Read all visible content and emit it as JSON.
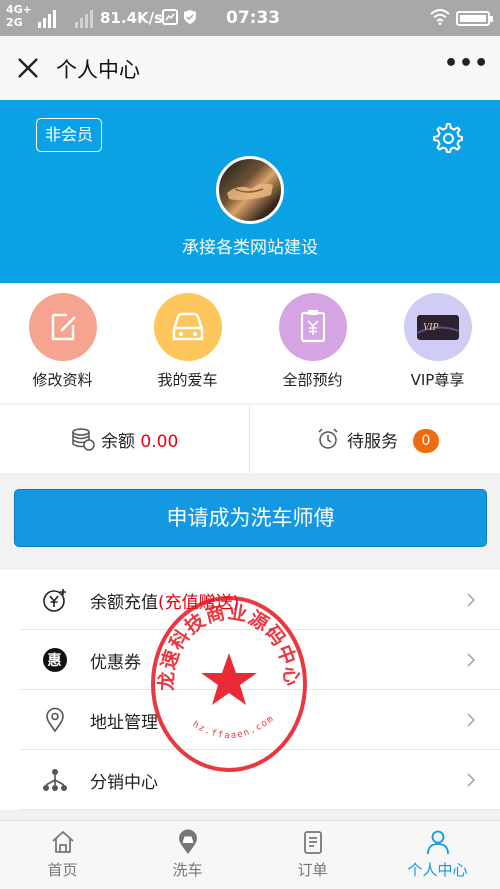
{
  "status_bar": {
    "network_top": "4G+",
    "network_bottom": "2G",
    "speed": "81.4K/s",
    "time": "07:33",
    "battery_level": 1.0,
    "icons": [
      "signal-icon",
      "image-notification-icon",
      "shield-icon",
      "wifi-icon",
      "battery-icon"
    ]
  },
  "title_bar": {
    "title": "个人中心",
    "close_icon": "close-icon",
    "more_icon": "more-icon",
    "more_text": "•••"
  },
  "profile": {
    "member_badge": "非会员",
    "username": "承接各类网站建设",
    "settings_icon": "gear-icon",
    "header_color": "#0aa2e5"
  },
  "quick_actions": [
    {
      "label": "修改资料",
      "icon": "edit-icon",
      "color": "#f6a38f"
    },
    {
      "label": "我的爱车",
      "icon": "car-icon",
      "color": "#fcc65c"
    },
    {
      "label": "全部预约",
      "icon": "appointment-icon",
      "color": "#d5a4e3"
    },
    {
      "label": "VIP尊享",
      "icon": "vip-card-icon",
      "color": "#cfcdf4"
    }
  ],
  "stats": {
    "balance_label": "余额",
    "balance_value": "0.00",
    "pending_label": "待服务",
    "pending_count": "0"
  },
  "apply_button": "申请成为洗车师傅",
  "menu": [
    {
      "label": "余额充值",
      "extra": "(充值赠送)",
      "icon": "recharge-icon"
    },
    {
      "label": "优惠券",
      "extra": "",
      "icon": "coupon-icon"
    },
    {
      "label": "地址管理",
      "extra": "",
      "icon": "location-icon"
    },
    {
      "label": "分销中心",
      "extra": "",
      "icon": "distribution-icon"
    }
  ],
  "watermark": {
    "text": "龙速科技商业源码中心",
    "url": "hz.ffaaen.com",
    "color": "#e8141f"
  },
  "tabs": [
    {
      "label": "首页",
      "icon": "home-icon",
      "active": false
    },
    {
      "label": "洗车",
      "icon": "wash-car-icon",
      "active": false
    },
    {
      "label": "订单",
      "icon": "order-icon",
      "active": false
    },
    {
      "label": "个人中心",
      "icon": "user-icon",
      "active": true
    }
  ],
  "colors": {
    "accent": "#1598e2",
    "badge": "#f06a0f",
    "price_red": "#e60012"
  }
}
